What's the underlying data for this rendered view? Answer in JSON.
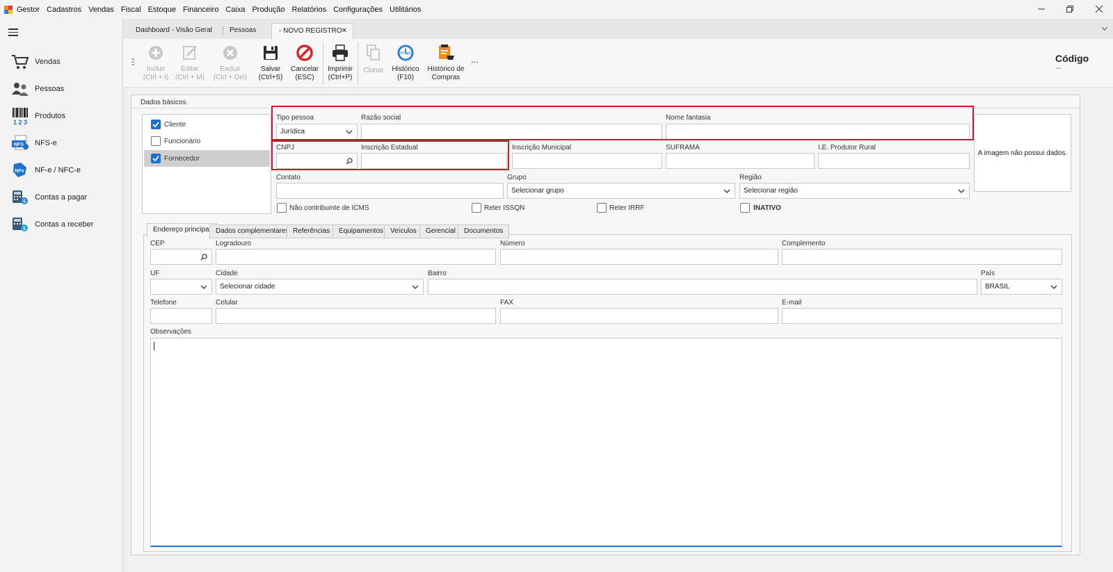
{
  "menu": {
    "app_name": "Gestor",
    "items": [
      "Cadastros",
      "Vendas",
      "Fiscal",
      "Estoque",
      "Financeiro",
      "Caixa",
      "Produção",
      "Relatórios",
      "Configurações",
      "Utilitários"
    ]
  },
  "sidebar": {
    "items": [
      {
        "label": "Vendas",
        "icon": "cart-icon"
      },
      {
        "label": "Pessoas",
        "icon": "people-icon"
      },
      {
        "label": "Produtos",
        "icon": "barcode-icon"
      },
      {
        "label": "NFS-e",
        "icon": "nfse-icon"
      },
      {
        "label": "NF-e / NFC-e",
        "icon": "nfe-icon"
      },
      {
        "label": "Contas a pagar",
        "icon": "calculator-icon"
      },
      {
        "label": "Contas a receber",
        "icon": "receivable-icon"
      }
    ]
  },
  "tabs": [
    {
      "label": "Dashboard - Visão Geral"
    },
    {
      "label": "Pessoas"
    },
    {
      "label": "- NOVO REGISTRO",
      "close": "✕"
    }
  ],
  "toolbar": {
    "incluir": {
      "line1": "Incluir",
      "line2": "(Ctrl + I)"
    },
    "editar": {
      "line1": "Editar",
      "line2": "(Ctrl + M)"
    },
    "excluir": {
      "line1": "Excluir",
      "line2": "(Ctrl + Del)"
    },
    "salvar": {
      "line1": "Salvar",
      "line2": "(Ctrl+S)"
    },
    "cancelar": {
      "line1": "Cancelar",
      "line2": "(ESC)"
    },
    "imprimir": {
      "line1": "Imprimir",
      "line2": "(Ctrl+P)"
    },
    "clonar": {
      "line1": "Clonar"
    },
    "historico": {
      "line1": "Histórico",
      "line2": "(F10)"
    },
    "historico_compras": {
      "line1": "Histórico de",
      "line2": "Compras"
    },
    "more": "...",
    "codigo_label": "Código",
    "codigo_value": "--"
  },
  "form": {
    "section_title": "Dados básicos",
    "roles": [
      {
        "label": "Cliente",
        "checked": true
      },
      {
        "label": "Funcionário",
        "checked": false
      },
      {
        "label": "Fornecedor",
        "checked": true
      }
    ],
    "tipo_pessoa": {
      "label": "Tipo pessoa",
      "value": "Jurídica"
    },
    "razao_social": {
      "label": "Razão social",
      "value": ""
    },
    "nome_fantasia": {
      "label": "Nome fantasia",
      "value": ""
    },
    "cnpj": {
      "label": "CNPJ",
      "value": ""
    },
    "inscricao_estadual": {
      "label": "Inscrição Estadual",
      "value": ""
    },
    "inscricao_municipal": {
      "label": "Inscrição Municipal",
      "value": ""
    },
    "suframa": {
      "label": "SUFRAMA",
      "value": ""
    },
    "ie_produtor_rural": {
      "label": "I.E. Produtor Rural",
      "value": ""
    },
    "contato": {
      "label": "Contato",
      "value": ""
    },
    "grupo": {
      "label": "Grupo",
      "value": "Selecionar grupo"
    },
    "regiao": {
      "label": "Região",
      "value": "Selecionar região"
    },
    "image_placeholder": "A imagem não possui dados.",
    "flags": [
      {
        "label": "Não contribuinte de ICMS",
        "checked": false
      },
      {
        "label": "Reter ISSQN",
        "checked": false
      },
      {
        "label": "Reter IRRF",
        "checked": false
      },
      {
        "label": "INATIVO",
        "checked": false
      }
    ]
  },
  "subtabs": [
    "Endereço principal",
    "Dados complementares",
    "Referências",
    "Equipamentos",
    "Veículos",
    "Gerencial",
    "Documentos"
  ],
  "address": {
    "cep": {
      "label": "CEP",
      "value": ""
    },
    "logradouro": {
      "label": "Logradouro",
      "value": ""
    },
    "numero": {
      "label": "Número",
      "value": ""
    },
    "complemento": {
      "label": "Complemento",
      "value": ""
    },
    "uf": {
      "label": "UF",
      "value": ""
    },
    "cidade": {
      "label": "Cidade",
      "value": "Selecionar cidade"
    },
    "bairro": {
      "label": "Bairro",
      "value": ""
    },
    "pais": {
      "label": "País",
      "value": "BRASIL"
    },
    "telefone": {
      "label": "Telefone",
      "value": ""
    },
    "celular": {
      "label": "Celular",
      "value": ""
    },
    "fax": {
      "label": "FAX",
      "value": ""
    },
    "email": {
      "label": "E-mail",
      "value": ""
    },
    "observacoes": {
      "label": "Observações",
      "value": ""
    }
  },
  "colors": {
    "accent": "#1f6fcf",
    "highlight_box": "#b3242b",
    "cancel_red": "#d9262c",
    "history_blue": "#2f7fd3",
    "orange": "#f08a1c"
  }
}
